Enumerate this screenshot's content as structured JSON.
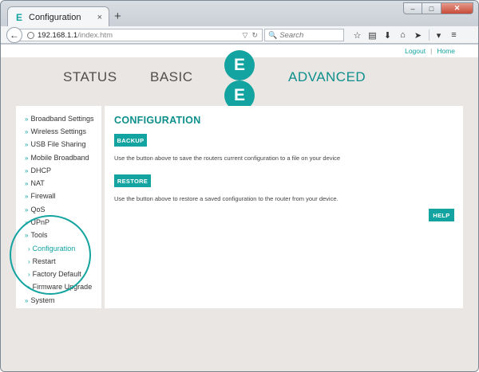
{
  "browser": {
    "tab_title": "Configuration",
    "tab_favicon_glyph": "E",
    "tab_close": "×",
    "new_tab": "+",
    "url_host": "192.168.1.1",
    "url_path": "/index.htm",
    "search_placeholder": "Search",
    "window_buttons": {
      "minimize": "‒",
      "maximize": "□",
      "close": "✕"
    }
  },
  "header": {
    "logout": "Logout",
    "separator": "|",
    "home": "Home"
  },
  "nav": {
    "status": "STATUS",
    "basic": "BASIC",
    "advanced": "ADVANCED",
    "logo_letter": "E"
  },
  "sidebar": {
    "items": [
      {
        "label": "Broadband Settings"
      },
      {
        "label": "Wireless Settings"
      },
      {
        "label": "USB File Sharing"
      },
      {
        "label": "Mobile Broadband"
      },
      {
        "label": "DHCP"
      },
      {
        "label": "NAT"
      },
      {
        "label": "Firewall"
      },
      {
        "label": "QoS"
      },
      {
        "label": "UPnP"
      },
      {
        "label": "Tools"
      },
      {
        "label": "Configuration"
      },
      {
        "label": "Restart"
      },
      {
        "label": "Factory Default"
      },
      {
        "label": "Firmware Upgrade"
      },
      {
        "label": "System"
      }
    ]
  },
  "main": {
    "title": "CONFIGURATION",
    "backup_label": "BACKUP",
    "backup_desc": "Use the button above to save the routers current configuration to a file on your device",
    "restore_label": "RESTORE",
    "restore_desc": "Use the button above to restore a saved configuration to the router from your device.",
    "help_label": "HELP"
  },
  "colors": {
    "brand": "#13a3a0",
    "brand_dark": "#0e8f8c",
    "page_background": "#e9e6e3"
  }
}
